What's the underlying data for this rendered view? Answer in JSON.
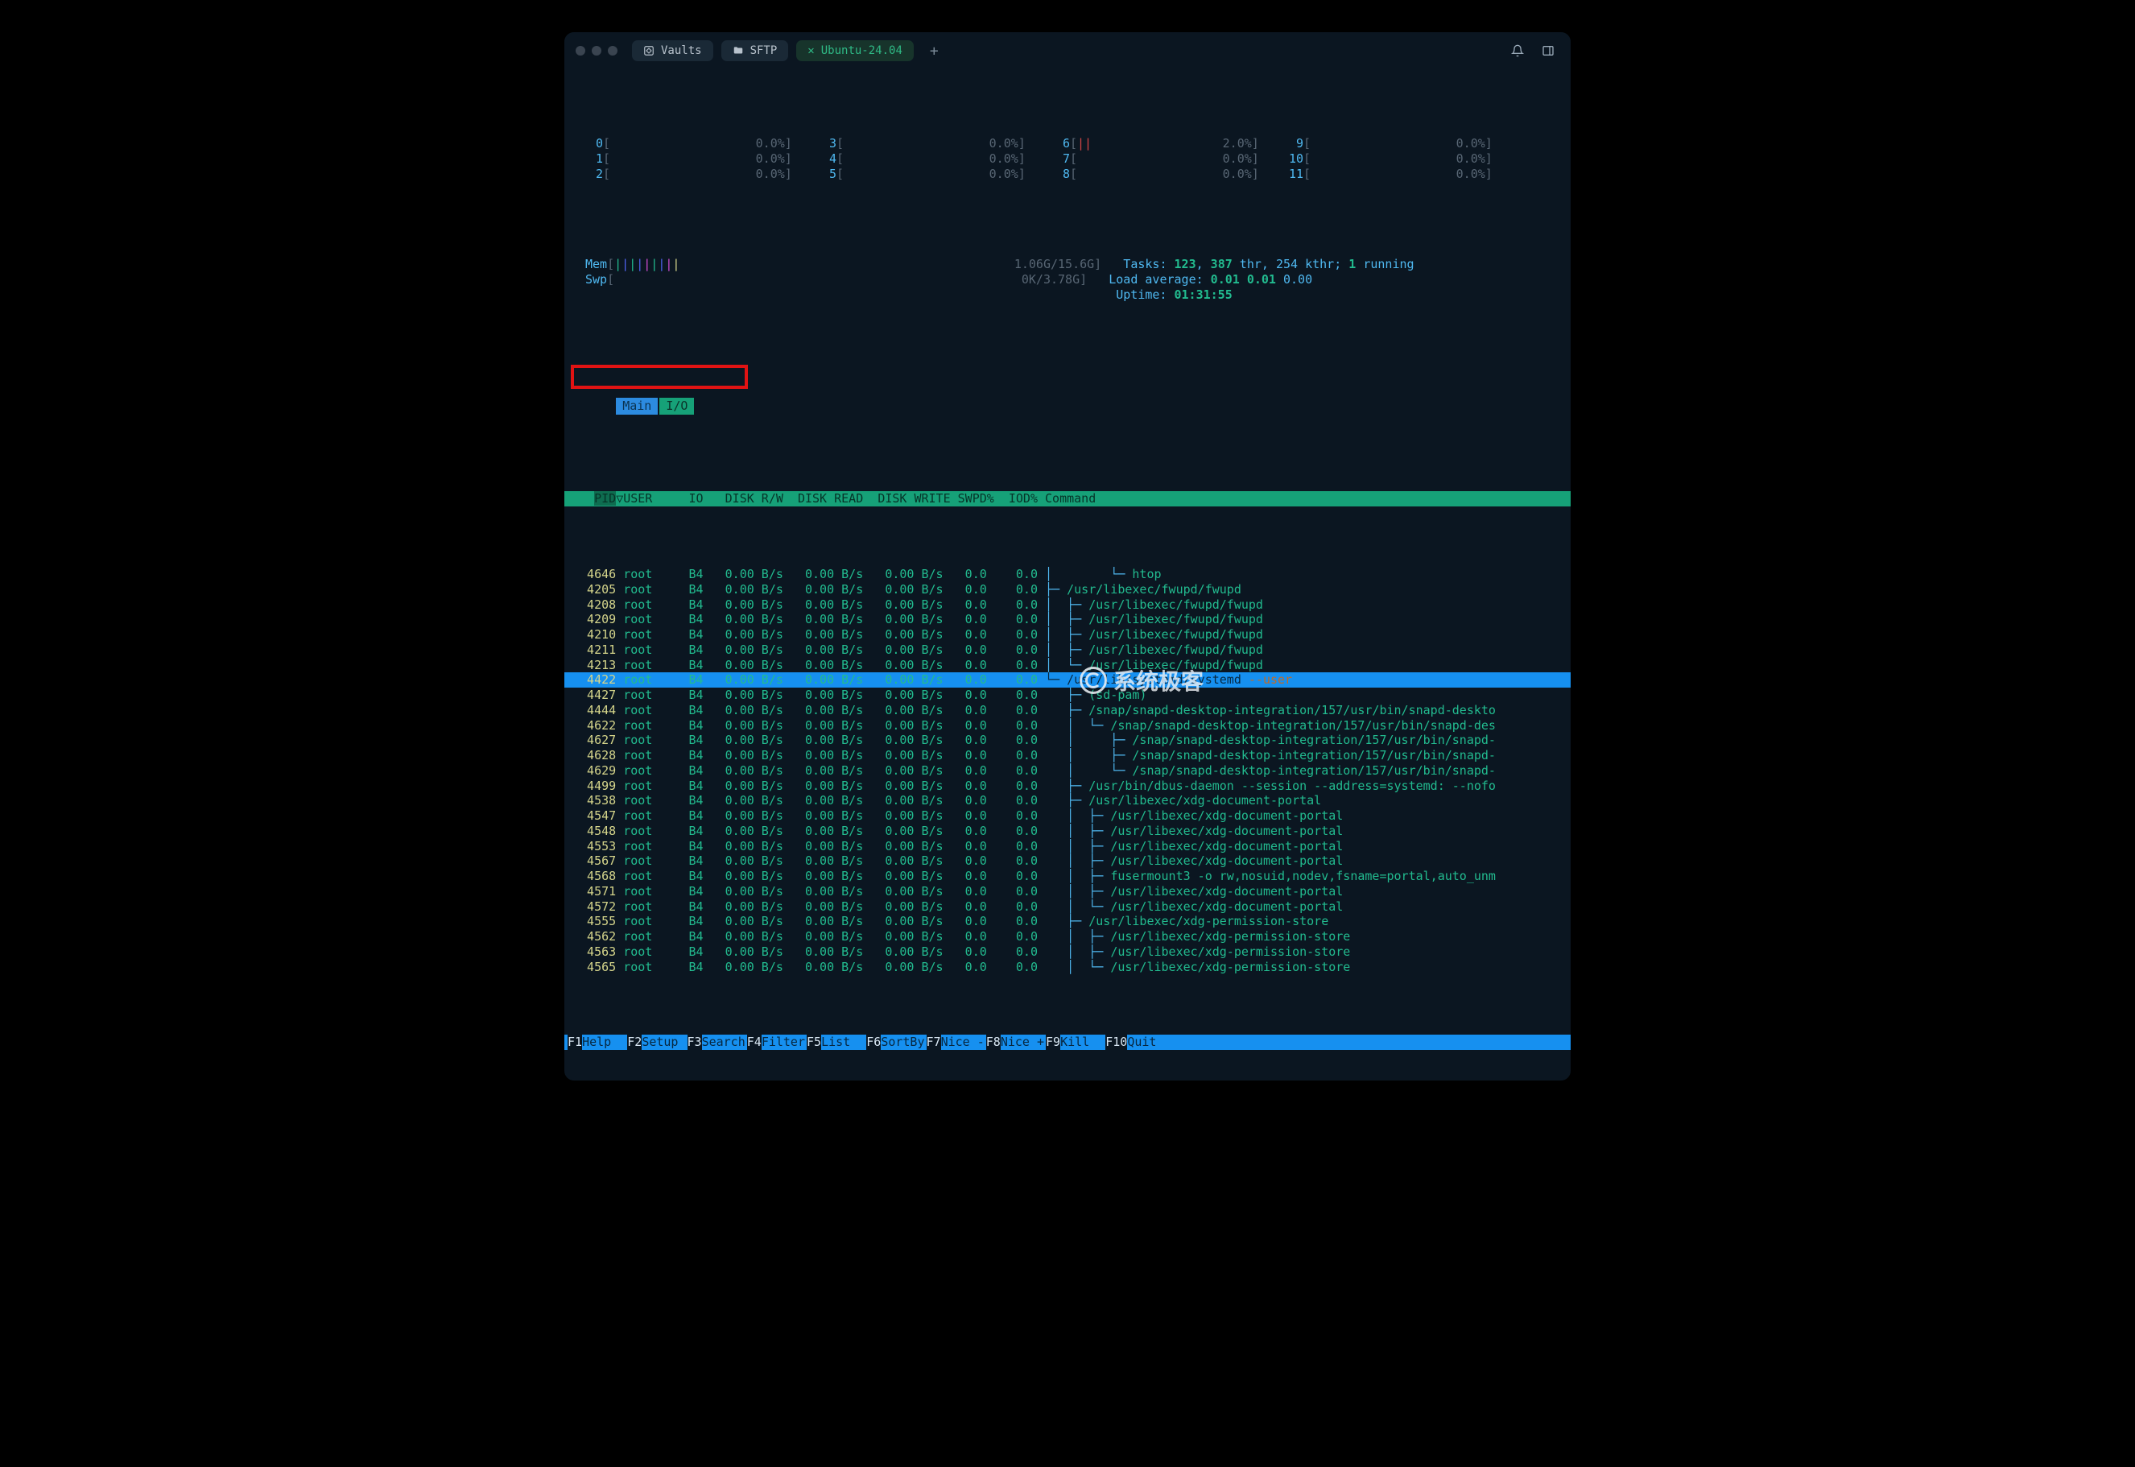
{
  "titlebar": {
    "tabs": [
      {
        "icon": "vault-icon",
        "label": "Vaults"
      },
      {
        "icon": "folder-icon",
        "label": "SFTP"
      }
    ],
    "active_tab": {
      "label": "Ubuntu-24.04"
    }
  },
  "cpus": [
    {
      "idx": "0",
      "pct": "0.0%",
      "fill": ""
    },
    {
      "idx": "3",
      "pct": "0.0%",
      "fill": ""
    },
    {
      "idx": "6",
      "pct": "2.0%",
      "fill": "||"
    },
    {
      "idx": "9",
      "pct": "0.0%",
      "fill": ""
    },
    {
      "idx": "1",
      "pct": "0.0%",
      "fill": ""
    },
    {
      "idx": "4",
      "pct": "0.0%",
      "fill": ""
    },
    {
      "idx": "7",
      "pct": "0.0%",
      "fill": ""
    },
    {
      "idx": "10",
      "pct": "0.0%",
      "fill": ""
    },
    {
      "idx": "2",
      "pct": "0.0%",
      "fill": ""
    },
    {
      "idx": "5",
      "pct": "0.0%",
      "fill": ""
    },
    {
      "idx": "8",
      "pct": "0.0%",
      "fill": ""
    },
    {
      "idx": "11",
      "pct": "0.0%",
      "fill": ""
    }
  ],
  "mem": {
    "label": "Mem",
    "bars": "|||||||||",
    "value": "1.06G/15.6G"
  },
  "swp": {
    "label": "Swp",
    "value": "0K/3.78G"
  },
  "tasks": {
    "label": "Tasks:",
    "procs": "123",
    "thr": "387",
    "thr_suffix": "thr,",
    "kthr": "254 kthr;",
    "running": "1",
    "running_suffix": "running"
  },
  "load": {
    "label": "Load average:",
    "v1": "0.01",
    "v2": "0.01",
    "v3": "0.00"
  },
  "uptime": {
    "label": "Uptime:",
    "value": "01:31:55"
  },
  "htop_tabs": {
    "main": "Main",
    "io": "I/O"
  },
  "columns": {
    "pid": "PID",
    "user": "USER",
    "io": "IO",
    "diskrw": "DISK R/W",
    "diskread": "DISK READ",
    "diskwrite": "DISK WRITE",
    "swpd": "SWPD%",
    "iod": "IOD%",
    "cmd": "Command"
  },
  "rows": [
    {
      "pid": "4646",
      "user": "root",
      "io": "B4",
      "rw": "0.00 B/s",
      "rd": "0.00 B/s",
      "wr": "0.00 B/s",
      "sw": "0.0",
      "iod": "0.0",
      "tree": "│        └─ ",
      "cmd": "htop"
    },
    {
      "pid": "4205",
      "user": "root",
      "io": "B4",
      "rw": "0.00 B/s",
      "rd": "0.00 B/s",
      "wr": "0.00 B/s",
      "sw": "0.0",
      "iod": "0.0",
      "tree": "├─ ",
      "cmd": "/usr/libexec/fwupd/fwupd"
    },
    {
      "pid": "4208",
      "user": "root",
      "io": "B4",
      "rw": "0.00 B/s",
      "rd": "0.00 B/s",
      "wr": "0.00 B/s",
      "sw": "0.0",
      "iod": "0.0",
      "tree": "│  ├─ ",
      "cmd": "/usr/libexec/fwupd/fwupd"
    },
    {
      "pid": "4209",
      "user": "root",
      "io": "B4",
      "rw": "0.00 B/s",
      "rd": "0.00 B/s",
      "wr": "0.00 B/s",
      "sw": "0.0",
      "iod": "0.0",
      "tree": "│  ├─ ",
      "cmd": "/usr/libexec/fwupd/fwupd"
    },
    {
      "pid": "4210",
      "user": "root",
      "io": "B4",
      "rw": "0.00 B/s",
      "rd": "0.00 B/s",
      "wr": "0.00 B/s",
      "sw": "0.0",
      "iod": "0.0",
      "tree": "│  ├─ ",
      "cmd": "/usr/libexec/fwupd/fwupd"
    },
    {
      "pid": "4211",
      "user": "root",
      "io": "B4",
      "rw": "0.00 B/s",
      "rd": "0.00 B/s",
      "wr": "0.00 B/s",
      "sw": "0.0",
      "iod": "0.0",
      "tree": "│  ├─ ",
      "cmd": "/usr/libexec/fwupd/fwupd"
    },
    {
      "pid": "4213",
      "user": "root",
      "io": "B4",
      "rw": "0.00 B/s",
      "rd": "0.00 B/s",
      "wr": "0.00 B/s",
      "sw": "0.0",
      "iod": "0.0",
      "tree": "│  └─ ",
      "cmd": "/usr/libexec/fwupd/fwupd"
    },
    {
      "pid": "4422",
      "user": "root",
      "io": "B4",
      "rw": "0.00 B/s",
      "rd": "0.00 B/s",
      "wr": "0.00 B/s",
      "sw": "0.0",
      "iod": "0.0",
      "tree": "└─ ",
      "cmd": "/usr/lib/systemd/systemd ",
      "arg": "--user",
      "sel": true
    },
    {
      "pid": "4427",
      "user": "root",
      "io": "B4",
      "rw": "0.00 B/s",
      "rd": "0.00 B/s",
      "wr": "0.00 B/s",
      "sw": "0.0",
      "iod": "0.0",
      "tree": "   ├─ ",
      "cmd": "(sd-pam)"
    },
    {
      "pid": "4444",
      "user": "root",
      "io": "B4",
      "rw": "0.00 B/s",
      "rd": "0.00 B/s",
      "wr": "0.00 B/s",
      "sw": "0.0",
      "iod": "0.0",
      "tree": "   ├─ ",
      "cmd": "/snap/snapd-desktop-integration/157/usr/bin/snapd-deskto"
    },
    {
      "pid": "4622",
      "user": "root",
      "io": "B4",
      "rw": "0.00 B/s",
      "rd": "0.00 B/s",
      "wr": "0.00 B/s",
      "sw": "0.0",
      "iod": "0.0",
      "tree": "   │  └─ ",
      "cmd": "/snap/snapd-desktop-integration/157/usr/bin/snapd-des"
    },
    {
      "pid": "4627",
      "user": "root",
      "io": "B4",
      "rw": "0.00 B/s",
      "rd": "0.00 B/s",
      "wr": "0.00 B/s",
      "sw": "0.0",
      "iod": "0.0",
      "tree": "   │     ├─ ",
      "cmd": "/snap/snapd-desktop-integration/157/usr/bin/snapd-"
    },
    {
      "pid": "4628",
      "user": "root",
      "io": "B4",
      "rw": "0.00 B/s",
      "rd": "0.00 B/s",
      "wr": "0.00 B/s",
      "sw": "0.0",
      "iod": "0.0",
      "tree": "   │     ├─ ",
      "cmd": "/snap/snapd-desktop-integration/157/usr/bin/snapd-"
    },
    {
      "pid": "4629",
      "user": "root",
      "io": "B4",
      "rw": "0.00 B/s",
      "rd": "0.00 B/s",
      "wr": "0.00 B/s",
      "sw": "0.0",
      "iod": "0.0",
      "tree": "   │     └─ ",
      "cmd": "/snap/snapd-desktop-integration/157/usr/bin/snapd-"
    },
    {
      "pid": "4499",
      "user": "root",
      "io": "B4",
      "rw": "0.00 B/s",
      "rd": "0.00 B/s",
      "wr": "0.00 B/s",
      "sw": "0.0",
      "iod": "0.0",
      "tree": "   ├─ ",
      "cmd": "/usr/bin/dbus-daemon --session --address=systemd: --nofo"
    },
    {
      "pid": "4538",
      "user": "root",
      "io": "B4",
      "rw": "0.00 B/s",
      "rd": "0.00 B/s",
      "wr": "0.00 B/s",
      "sw": "0.0",
      "iod": "0.0",
      "tree": "   ├─ ",
      "cmd": "/usr/libexec/xdg-document-portal"
    },
    {
      "pid": "4547",
      "user": "root",
      "io": "B4",
      "rw": "0.00 B/s",
      "rd": "0.00 B/s",
      "wr": "0.00 B/s",
      "sw": "0.0",
      "iod": "0.0",
      "tree": "   │  ├─ ",
      "cmd": "/usr/libexec/xdg-document-portal"
    },
    {
      "pid": "4548",
      "user": "root",
      "io": "B4",
      "rw": "0.00 B/s",
      "rd": "0.00 B/s",
      "wr": "0.00 B/s",
      "sw": "0.0",
      "iod": "0.0",
      "tree": "   │  ├─ ",
      "cmd": "/usr/libexec/xdg-document-portal"
    },
    {
      "pid": "4553",
      "user": "root",
      "io": "B4",
      "rw": "0.00 B/s",
      "rd": "0.00 B/s",
      "wr": "0.00 B/s",
      "sw": "0.0",
      "iod": "0.0",
      "tree": "   │  ├─ ",
      "cmd": "/usr/libexec/xdg-document-portal"
    },
    {
      "pid": "4567",
      "user": "root",
      "io": "B4",
      "rw": "0.00 B/s",
      "rd": "0.00 B/s",
      "wr": "0.00 B/s",
      "sw": "0.0",
      "iod": "0.0",
      "tree": "   │  ├─ ",
      "cmd": "/usr/libexec/xdg-document-portal"
    },
    {
      "pid": "4568",
      "user": "root",
      "io": "B4",
      "rw": "0.00 B/s",
      "rd": "0.00 B/s",
      "wr": "0.00 B/s",
      "sw": "0.0",
      "iod": "0.0",
      "tree": "   │  ├─ ",
      "cmd": "fusermount3 -o rw,nosuid,nodev,fsname=portal,auto_unm"
    },
    {
      "pid": "4571",
      "user": "root",
      "io": "B4",
      "rw": "0.00 B/s",
      "rd": "0.00 B/s",
      "wr": "0.00 B/s",
      "sw": "0.0",
      "iod": "0.0",
      "tree": "   │  ├─ ",
      "cmd": "/usr/libexec/xdg-document-portal"
    },
    {
      "pid": "4572",
      "user": "root",
      "io": "B4",
      "rw": "0.00 B/s",
      "rd": "0.00 B/s",
      "wr": "0.00 B/s",
      "sw": "0.0",
      "iod": "0.0",
      "tree": "   │  └─ ",
      "cmd": "/usr/libexec/xdg-document-portal"
    },
    {
      "pid": "4555",
      "user": "root",
      "io": "B4",
      "rw": "0.00 B/s",
      "rd": "0.00 B/s",
      "wr": "0.00 B/s",
      "sw": "0.0",
      "iod": "0.0",
      "tree": "   ├─ ",
      "cmd": "/usr/libexec/xdg-permission-store"
    },
    {
      "pid": "4562",
      "user": "root",
      "io": "B4",
      "rw": "0.00 B/s",
      "rd": "0.00 B/s",
      "wr": "0.00 B/s",
      "sw": "0.0",
      "iod": "0.0",
      "tree": "   │  ├─ ",
      "cmd": "/usr/libexec/xdg-permission-store"
    },
    {
      "pid": "4563",
      "user": "root",
      "io": "B4",
      "rw": "0.00 B/s",
      "rd": "0.00 B/s",
      "wr": "0.00 B/s",
      "sw": "0.0",
      "iod": "0.0",
      "tree": "   │  ├─ ",
      "cmd": "/usr/libexec/xdg-permission-store"
    },
    {
      "pid": "4565",
      "user": "root",
      "io": "B4",
      "rw": "0.00 B/s",
      "rd": "0.00 B/s",
      "wr": "0.00 B/s",
      "sw": "0.0",
      "iod": "0.0",
      "tree": "   │  └─ ",
      "cmd": "/usr/libexec/xdg-permission-store"
    }
  ],
  "fkeys": [
    {
      "k": "F1",
      "l": "Help  "
    },
    {
      "k": "F2",
      "l": "Setup "
    },
    {
      "k": "F3",
      "l": "Search"
    },
    {
      "k": "F4",
      "l": "Filter"
    },
    {
      "k": "F5",
      "l": "List  "
    },
    {
      "k": "F6",
      "l": "SortBy"
    },
    {
      "k": "F7",
      "l": "Nice -"
    },
    {
      "k": "F8",
      "l": "Nice +"
    },
    {
      "k": "F9",
      "l": "Kill  "
    },
    {
      "k": "F10",
      "l": "Quit  "
    }
  ],
  "watermark": "系统极客"
}
